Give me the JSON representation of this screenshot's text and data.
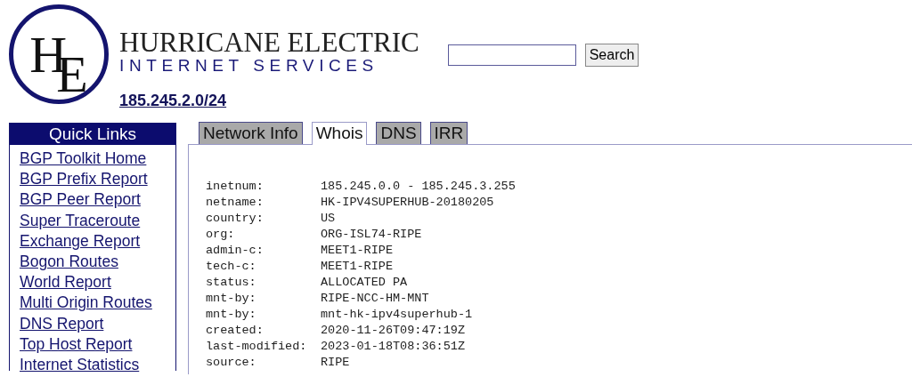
{
  "logo": {
    "monogram": "HE",
    "name": "HURRICANE ELECTRIC",
    "tagline": "INTERNET SERVICES"
  },
  "search": {
    "button": "Search"
  },
  "prefix": "185.245.2.0/24",
  "quick_links": {
    "title": "Quick Links",
    "items": [
      "BGP Toolkit Home",
      "BGP Prefix Report",
      "BGP Peer Report",
      "Super Traceroute",
      "Exchange Report",
      "Bogon Routes",
      "World Report",
      "Multi Origin Routes",
      "DNS Report",
      "Top Host Report",
      "Internet Statistics"
    ]
  },
  "tabs": [
    {
      "label": "Network Info",
      "selected": false
    },
    {
      "label": "Whois",
      "selected": true
    },
    {
      "label": "DNS",
      "selected": false
    },
    {
      "label": "IRR",
      "selected": false
    }
  ],
  "whois": [
    {
      "key": "inetnum:",
      "value": "185.245.0.0 - 185.245.3.255"
    },
    {
      "key": "netname:",
      "value": "HK-IPV4SUPERHUB-20180205"
    },
    {
      "key": "country:",
      "value": "US"
    },
    {
      "key": "org:",
      "value": "ORG-ISL74-RIPE"
    },
    {
      "key": "admin-c:",
      "value": "MEET1-RIPE"
    },
    {
      "key": "tech-c:",
      "value": "MEET1-RIPE"
    },
    {
      "key": "status:",
      "value": "ALLOCATED PA"
    },
    {
      "key": "mnt-by:",
      "value": "RIPE-NCC-HM-MNT"
    },
    {
      "key": "mnt-by:",
      "value": "mnt-hk-ipv4superhub-1"
    },
    {
      "key": "created:",
      "value": "2020-11-26T09:47:19Z"
    },
    {
      "key": "last-modified:",
      "value": "2023-01-18T08:36:51Z"
    },
    {
      "key": "source:",
      "value": "RIPE"
    }
  ]
}
